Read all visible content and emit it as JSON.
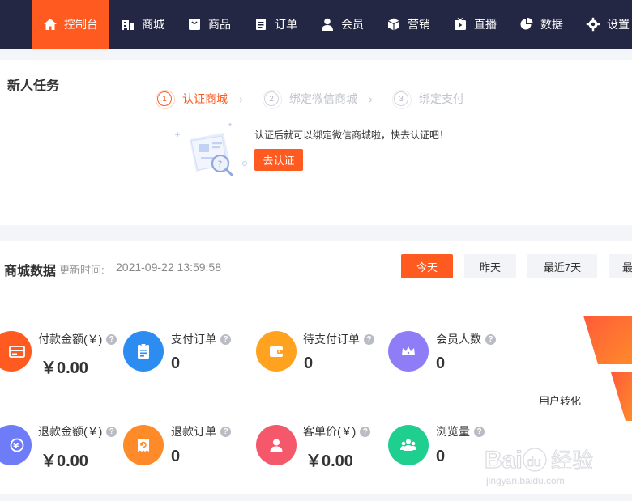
{
  "nav": {
    "items": [
      {
        "label": "控制台",
        "icon": "home-icon"
      },
      {
        "label": "商城",
        "icon": "store-icon"
      },
      {
        "label": "商品",
        "icon": "goods-icon"
      },
      {
        "label": "订单",
        "icon": "order-icon"
      },
      {
        "label": "会员",
        "icon": "member-icon"
      },
      {
        "label": "营销",
        "icon": "marketing-icon"
      },
      {
        "label": "直播",
        "icon": "live-icon"
      },
      {
        "label": "数据",
        "icon": "data-pie-icon"
      },
      {
        "label": "设置",
        "icon": "settings-gear-icon"
      }
    ],
    "active_color": "#ff5a1f",
    "bg_color": "#232743"
  },
  "task": {
    "title": "新人任务",
    "steps": [
      {
        "num": "1",
        "label": "认证商城"
      },
      {
        "num": "2",
        "label": "绑定微信商城"
      },
      {
        "num": "3",
        "label": "绑定支付"
      }
    ],
    "description": "认证后就可以绑定微信商城啦，快去认证吧！",
    "button": "去认证"
  },
  "shop": {
    "title": "商城数据",
    "update_label": "更新时间:",
    "update_time": "2021-09-22 13:59:58",
    "periods": [
      "今天",
      "昨天",
      "最近7天",
      "最"
    ],
    "stats": [
      {
        "label": "付款金额(￥)",
        "value": "￥0.00",
        "icon": "card-icon",
        "color": "#ff5a1f"
      },
      {
        "label": "支付订单",
        "value": "0",
        "icon": "clipboard-icon",
        "color": "#2d8cf0"
      },
      {
        "label": "待支付订单",
        "value": "0",
        "icon": "wallet-icon",
        "color": "#ffa21f"
      },
      {
        "label": "会员人数",
        "value": "0",
        "icon": "crown-icon",
        "color": "#8f7cf7"
      },
      {
        "label": "退款金额(￥)",
        "value": "￥0.00",
        "icon": "yuan-refund-icon",
        "color": "#6f7cf7"
      },
      {
        "label": "退款订单",
        "value": "0",
        "icon": "refund-receipt-icon",
        "color": "#ff8a2a"
      },
      {
        "label": "客单价(￥)",
        "value": "￥0.00",
        "icon": "person-icon",
        "color": "#f5586a"
      },
      {
        "label": "浏览量",
        "value": "0",
        "icon": "people-icon",
        "color": "#1fcf8f"
      }
    ],
    "conversion_label": "用户转化"
  },
  "watermark": {
    "text": "Baidu经验",
    "subtext": "jingyan.baidu.com"
  }
}
